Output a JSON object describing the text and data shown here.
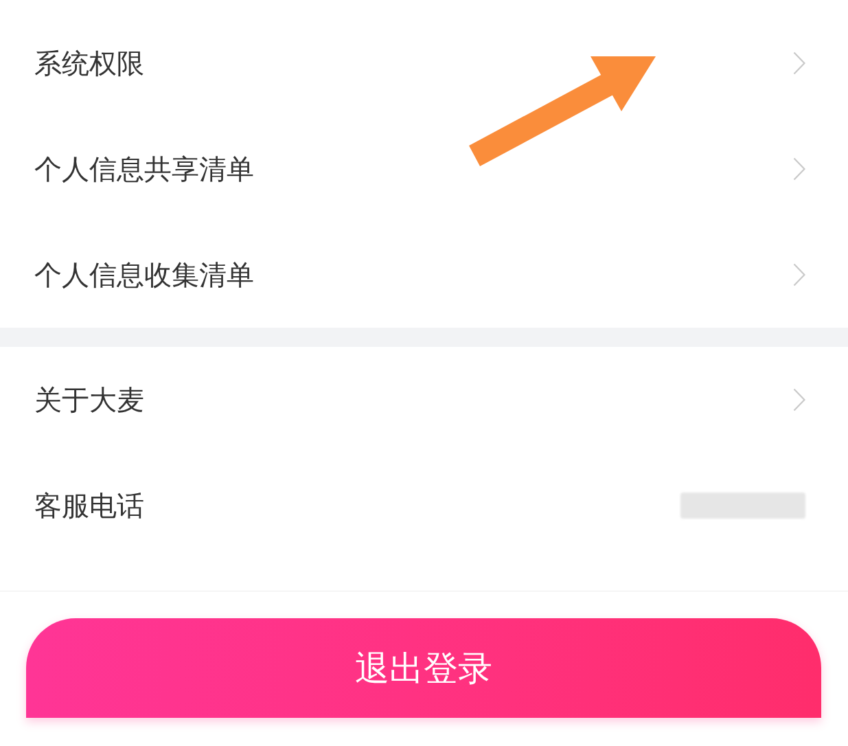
{
  "sections": [
    {
      "rows": [
        {
          "kind": "link",
          "label": "系统权限"
        },
        {
          "kind": "link",
          "label": "个人信息共享清单"
        },
        {
          "kind": "link",
          "label": "个人信息收集清单"
        }
      ]
    },
    {
      "rows": [
        {
          "kind": "link",
          "label": "关于大麦"
        },
        {
          "kind": "value",
          "label": "客服电话"
        }
      ]
    }
  ],
  "logout_button": {
    "label": "退出登录"
  }
}
